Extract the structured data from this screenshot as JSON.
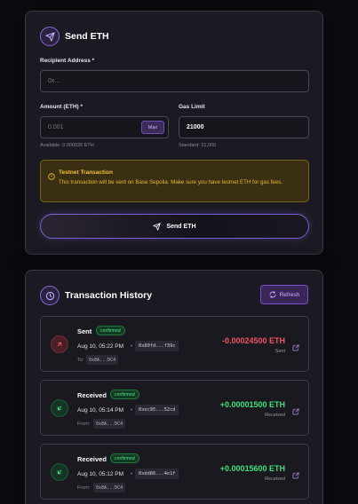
{
  "send": {
    "title": "Send ETH",
    "recipient_label": "Recipient Address *",
    "recipient_placeholder": "0x...",
    "amount_label": "Amount (ETH) *",
    "amount_placeholder": "0.001",
    "max_label": "Max",
    "available": "Available: 0.000026 ETH",
    "gas_label": "Gas Limit",
    "gas_value": "21000",
    "gas_hint": "Standard: 21,000",
    "warning_title": "Testnet Transaction",
    "warning_text": "This transaction will be sent on Base Sepolia. Make sure you have testnet ETH for gas fees.",
    "button_label": "Send ETH"
  },
  "history": {
    "title": "Transaction History",
    "refresh_label": "Refresh",
    "items": [
      {
        "type": "Sent",
        "status": "confirmed",
        "time": "Aug 10, 05:22 PM",
        "hash": "0x80fd...f39c",
        "party_label": "To:",
        "party_addr": "0x8A...DC4",
        "amount": "-0.00024500 ETH",
        "direction": "Sent"
      },
      {
        "type": "Received",
        "status": "confirmed",
        "time": "Aug 10, 05:14 PM",
        "hash": "0xec95...52cd",
        "party_label": "From:",
        "party_addr": "0x8A...DC4",
        "amount": "+0.00001500 ETH",
        "direction": "Received"
      },
      {
        "type": "Received",
        "status": "confirmed",
        "time": "Aug 10, 05:12 PM",
        "hash": "0xdd86...4e1f",
        "party_label": "From:",
        "party_addr": "0x8A...DC4",
        "amount": "+0.00015600 ETH",
        "direction": "Received"
      }
    ]
  },
  "colors": {
    "accent": "#8b6ad6",
    "negative": "#f05565",
    "positive": "#3ee27a",
    "warning": "#f2c233"
  },
  "icons": [
    "send-icon",
    "clock-icon",
    "refresh-icon",
    "warning-icon",
    "arrow-up-right-icon",
    "arrow-down-left-icon",
    "external-link-icon"
  ]
}
